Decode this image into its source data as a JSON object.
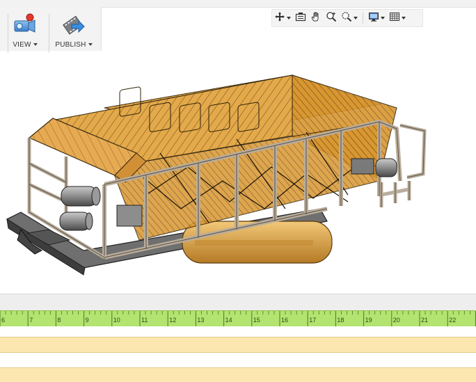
{
  "ribbon": {
    "view": {
      "label": "VIEW",
      "icon": "video-camera-icon"
    },
    "publish": {
      "label": "PUBLISH",
      "icon": "film-arrow-icon"
    }
  },
  "navbar": [
    {
      "name": "pan-icon",
      "caret": true
    },
    {
      "name": "capture-icon",
      "caret": false
    },
    {
      "name": "hand-icon",
      "caret": false
    },
    {
      "name": "zoom-icon",
      "caret": false
    },
    {
      "name": "zoom-window-icon",
      "caret": true
    },
    {
      "name": "display-icon",
      "caret": true
    },
    {
      "name": "grid-icon",
      "caret": true
    }
  ],
  "timeline": {
    "ruler_ticks": [
      "6",
      "7",
      "8",
      "9",
      "10",
      "11",
      "12",
      "13",
      "14",
      "15",
      "16",
      "17",
      "18",
      "19",
      "20",
      "21",
      "22",
      "2"
    ]
  },
  "colors": {
    "ruler": "#b3e370",
    "track": "#fde7b1",
    "panel_fill": "#e3a94a",
    "frame": "#bfb3a3"
  }
}
